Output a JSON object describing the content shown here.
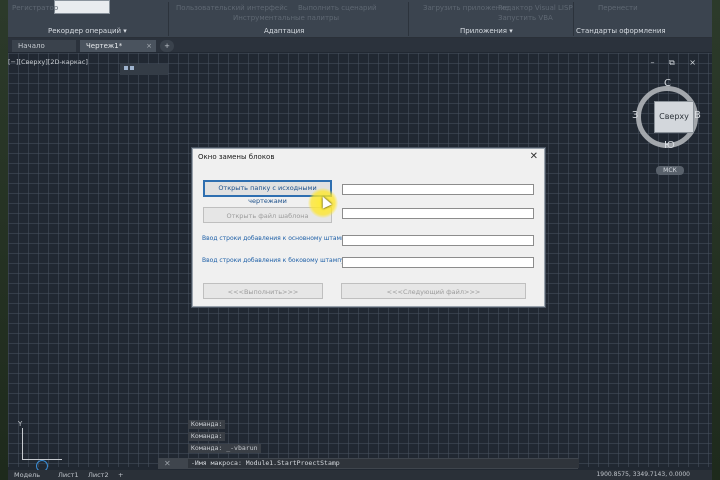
{
  "ribbon": {
    "faded": [
      "Регистратор",
      "Пользовательский интерфейс",
      "Инструментальные палитры",
      "Загрузить приложение",
      "Редактор Visual LISP",
      "Запустить VBA",
      "Перенести",
      "Выполнить сценарий"
    ],
    "panels": [
      "Рекордер операций",
      "Адаптация",
      "Приложения",
      "Стандарты оформления"
    ]
  },
  "tabs": {
    "start": "Начало",
    "drawing": "Чертеж1*",
    "close": "×",
    "plus": "+"
  },
  "viewport": {
    "label": "[−][Сверху][2D-каркас]",
    "window_controls": "– ⧉ ×"
  },
  "viewcube": {
    "face": "Сверху",
    "north": "С",
    "south": "Ю",
    "west": "З",
    "east": "В",
    "ucs": "МСК"
  },
  "dialog": {
    "title": "Окно замены блоков",
    "close": "✕",
    "open_folder_button": "Открыть папку с исходными чертежами",
    "open_template_button": "Открыть файл шаблона",
    "main_stamp_label": "Ввод строки добавления к основному штампу:",
    "side_stamp_label": "Ввод строки добавления к боковому штампу:",
    "execute_button": "<<<Выполнить>>>",
    "next_file_button": "<<<Следующий файл>>>"
  },
  "command_history": [
    "Команда:",
    "Команда:",
    "Команда: _-vbarun"
  ],
  "command_line": {
    "close": "✕",
    "prompt": "-Имя макроса: Module1.StartProectStamp"
  },
  "status_bar": {
    "tabs": [
      "Модель",
      "Лист1",
      "Лист2",
      "+"
    ],
    "coords": "1900.8575, 3349.7143, 0.0000"
  },
  "colors": {
    "accent": "#2f6fb0",
    "highlight": "#ffec28",
    "dialog_bg": "#f0f0f0",
    "background": "#212832"
  }
}
